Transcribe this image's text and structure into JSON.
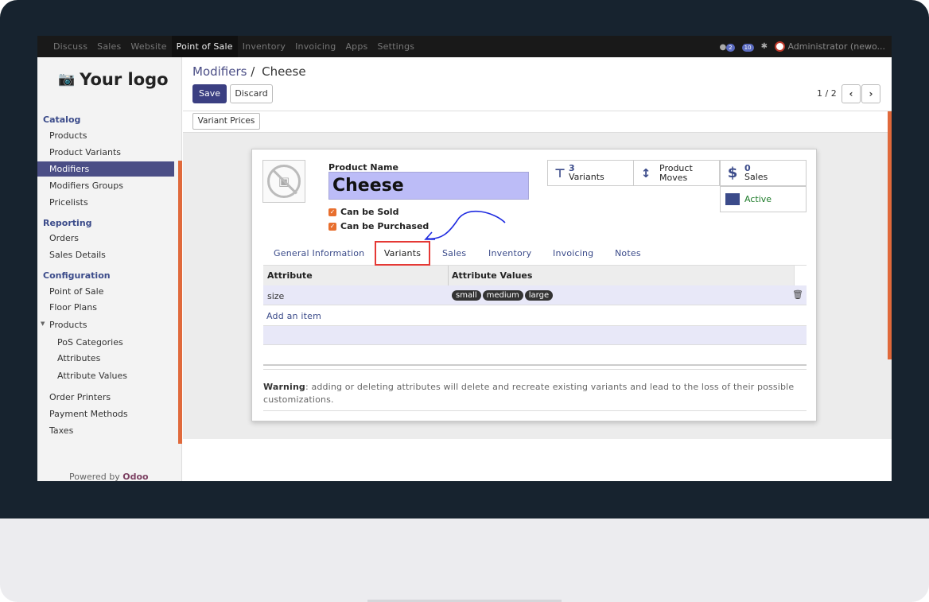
{
  "topbar": {
    "menu": [
      "Discuss",
      "Sales",
      "Website",
      "Point of Sale",
      "Inventory",
      "Invoicing",
      "Apps",
      "Settings"
    ],
    "active_index": 3,
    "chat_badge": "2",
    "activity_badge": "10",
    "user": "Administrator (newo..."
  },
  "sidebar": {
    "logo_text": "Your logo",
    "sections": {
      "catalog": "Catalog",
      "reporting": "Reporting",
      "configuration": "Configuration"
    },
    "catalog_items": [
      "Products",
      "Product Variants",
      "Modifiers",
      "Modifiers Groups",
      "Pricelists"
    ],
    "active_item": "Modifiers",
    "reporting_items": [
      "Orders",
      "Sales Details"
    ],
    "config_items": [
      "Point of Sale",
      "Floor Plans",
      "Products"
    ],
    "products_subitems": [
      "PoS Categories",
      "Attributes",
      "Attribute Values"
    ],
    "config_items_2": [
      "Order Printers",
      "Payment Methods",
      "Taxes"
    ],
    "powered_prefix": "Powered by",
    "powered_brand": "Odoo"
  },
  "control_panel": {
    "breadcrumb_parent": "Modifiers",
    "breadcrumb_sep": "/",
    "breadcrumb_current": "Cheese",
    "save_label": "Save",
    "discard_label": "Discard",
    "pager": "1 / 2",
    "prev_icon": "‹",
    "next_icon": "›"
  },
  "statusbar": {
    "variant_prices_label": "Variant Prices"
  },
  "form": {
    "product_name_label": "Product Name",
    "product_name": "Cheese",
    "can_be_sold": "Can be Sold",
    "can_be_purchased": "Can be Purchased",
    "smart_buttons": {
      "variants_count": "3",
      "variants_label": "Variants",
      "product_moves_line1": "Product",
      "product_moves_line2": "Moves",
      "sales_count": "0",
      "sales_label": "Sales",
      "active_label": "Active"
    },
    "tabs": [
      "General Information",
      "Variants",
      "Sales",
      "Inventory",
      "Invoicing",
      "Notes"
    ],
    "active_tab": "Variants",
    "table": {
      "headers": [
        "Attribute",
        "Attribute Values"
      ],
      "rows": [
        {
          "attribute": "size",
          "values": [
            "small",
            "medium",
            "large"
          ]
        }
      ],
      "add_item": "Add an item"
    },
    "warning_label": "Warning",
    "warning_text": ": adding or deleting attributes will delete and recreate existing variants and lead to the loss of their possible customizations."
  },
  "colors": {
    "topbar_bg": "#191919",
    "brand_purple": "#3b3f82",
    "sidebar_active": "#4b4e86",
    "accent_orange": "#e0693b",
    "tab_highlight": "#e53935",
    "annotation_arrow": "#1f2be0"
  }
}
